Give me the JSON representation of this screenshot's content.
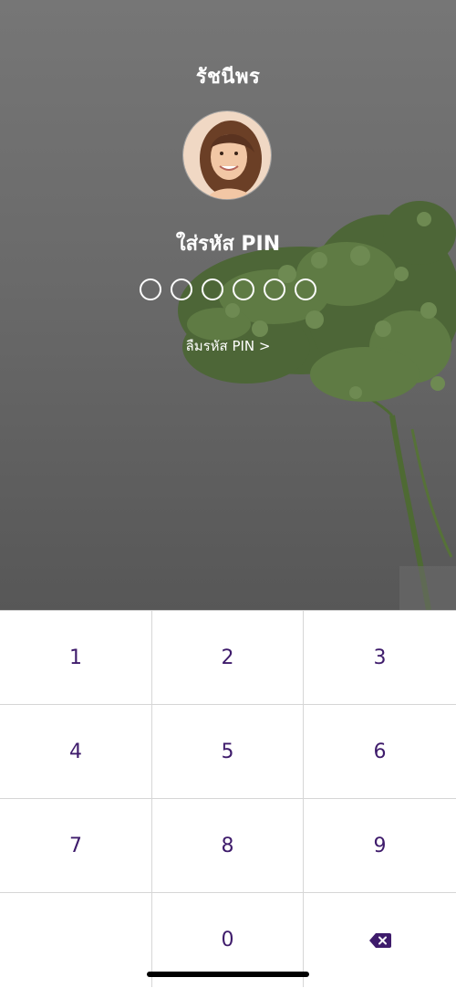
{
  "lock_screen": {
    "user_name": "รัชนีพร",
    "pin_title": "ใส่รหัส PIN",
    "pin_length": 6,
    "pin_entered": 0,
    "forgot_link": "ลืมรหัส PIN >"
  },
  "keypad": {
    "keys": [
      "1",
      "2",
      "3",
      "4",
      "5",
      "6",
      "7",
      "8",
      "9",
      "",
      "0"
    ],
    "delete_icon": "backspace-icon"
  },
  "colors": {
    "key_text": "#3e1b6b",
    "background_top": "#767676",
    "background_bottom": "#575757",
    "plant": "#4f6a38"
  }
}
